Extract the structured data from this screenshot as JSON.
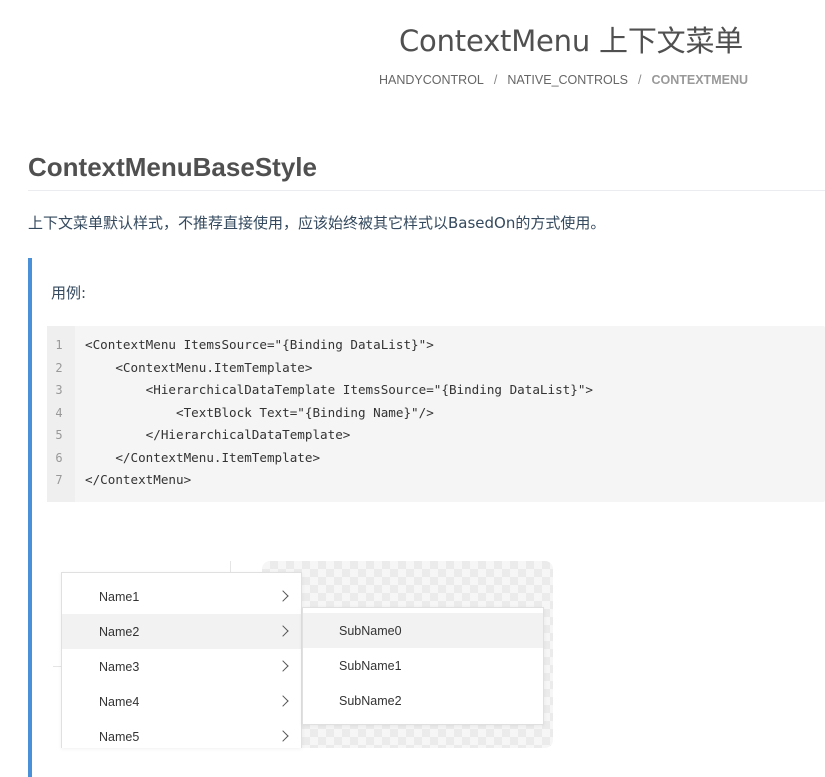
{
  "page": {
    "title": "ContextMenu 上下文菜单",
    "breadcrumb": {
      "items": [
        "HANDYCONTROL",
        "NATIVE_CONTROLS"
      ],
      "current": "CONTEXTMENU",
      "separator": "/"
    }
  },
  "section": {
    "heading": "ContextMenuBaseStyle",
    "description": "上下文菜单默认样式，不推荐直接使用，应该始终被其它样式以BasedOn的方式使用。"
  },
  "example": {
    "label": "用例:",
    "code_lines": [
      "<ContextMenu ItemsSource=\"{Binding DataList}\">",
      "    <ContextMenu.ItemTemplate>",
      "        <HierarchicalDataTemplate ItemsSource=\"{Binding DataList}\">",
      "            <TextBlock Text=\"{Binding Name}\"/>",
      "        </HierarchicalDataTemplate>",
      "    </ContextMenu.ItemTemplate>",
      "</ContextMenu>"
    ],
    "line_numbers": [
      "1",
      "2",
      "3",
      "4",
      "5",
      "6",
      "7"
    ]
  },
  "demo": {
    "menu_items": [
      "Name1",
      "Name2",
      "Name3",
      "Name4",
      "Name5"
    ],
    "hovered_menu_item": "Name2",
    "submenu_items": [
      "SubName0",
      "SubName1",
      "SubName2"
    ],
    "hovered_submenu_item": "SubName0"
  },
  "colors": {
    "accent_bar": "#4a90d9",
    "code_background": "#f5f5f5",
    "hover_background": "#f2f2f2"
  }
}
